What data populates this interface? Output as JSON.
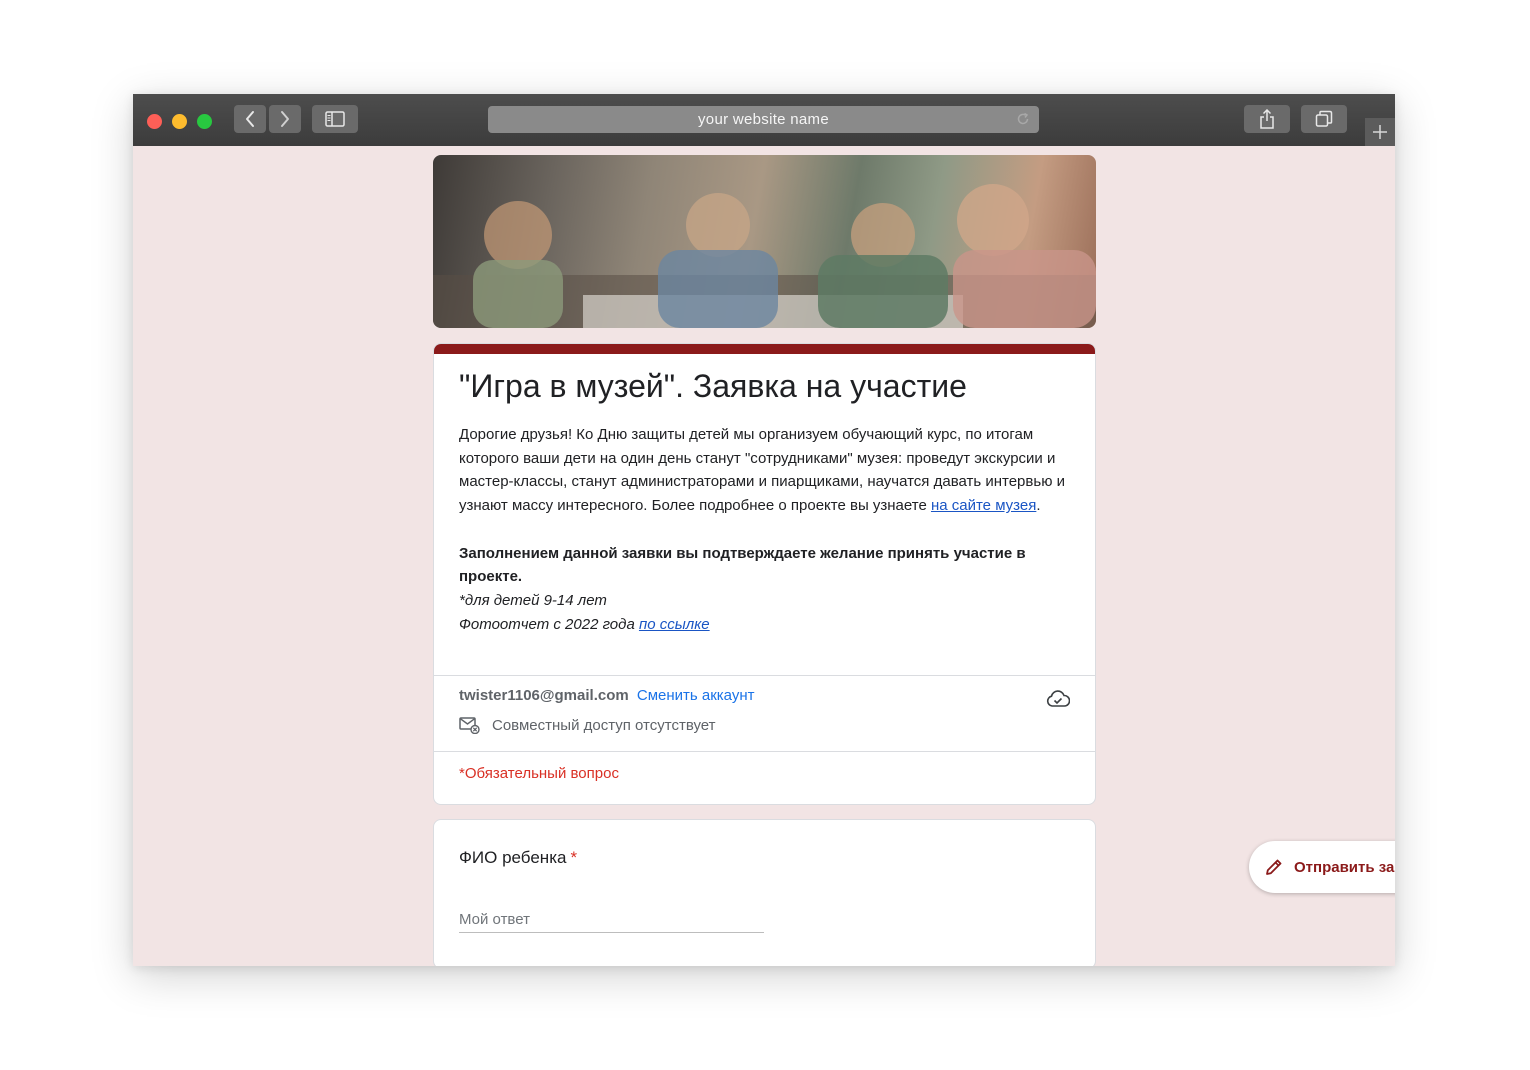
{
  "browser": {
    "url": "your website name",
    "colors": {
      "close": "#fe5f57",
      "minimize": "#febc2e",
      "maximize": "#28c840"
    }
  },
  "form": {
    "title": "\"Игра в музей\". Заявка на участие",
    "accent_color": "#8b1a1a",
    "description": {
      "intro": "Дорогие друзья! Ко Дню защиты детей мы организуем обучающий курс, по итогам которого ваши дети на один день станут \"сотрудниками\" музея: проведут экскурсии и мастер-классы, станут администраторами и пиарщиками, научатся давать интервью и узнают массу интересного. Более подробнее о проекте вы узнаете ",
      "intro_link": "на сайте музея",
      "intro_end": ".",
      "confirm": "Заполнением данной заявки вы подтверждаете желание принять участие в проекте.",
      "age": "*для детей 9-14 лет",
      "photo": "Фотоотчет с 2022 года ",
      "photo_link": "по ссылке"
    },
    "account": {
      "email": "twister1106@gmail.com",
      "switch_label": "Сменить аккаунт",
      "sharing": "Совместный доступ отсутствует"
    },
    "required_note": "*Обязательный вопрос",
    "questions": [
      {
        "label": "ФИО ребенка",
        "required_mark": "*",
        "placeholder": "Мой ответ"
      }
    ],
    "send_label": "Отправить заполнение"
  }
}
